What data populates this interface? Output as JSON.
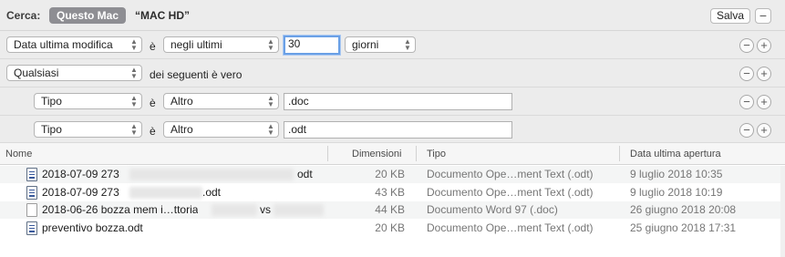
{
  "search": {
    "label": "Cerca:",
    "scope_active": "Questo Mac",
    "scope_other": "“MAC HD”",
    "save_label": "Salva",
    "minus": "−"
  },
  "criteria": [
    {
      "attribute": "Data ultima modifica",
      "op": "è",
      "cond": "negli ultimi",
      "value": "30",
      "unit": "giorni"
    },
    {
      "attribute": "Qualsiasi",
      "text": "dei seguenti è vero"
    },
    {
      "attribute": "Tipo",
      "op": "è",
      "cond": "Altro",
      "value": ".doc"
    },
    {
      "attribute": "Tipo",
      "op": "è",
      "cond": "Altro",
      "value": ".odt"
    }
  ],
  "buttons": {
    "minus": "−",
    "plus": "+"
  },
  "columns": {
    "name": "Nome",
    "size": "Dimensioni",
    "kind": "Tipo",
    "date": "Data ultima apertura"
  },
  "files": [
    {
      "name_start": "2018-07-09 273",
      "name_end": "odt",
      "size": "20 KB",
      "kind": "Documento Ope…ment Text (.odt)",
      "date": "9 luglio 2018 10:35",
      "icon": "odt-document-icon"
    },
    {
      "name_start": "2018-07-09 273",
      "name_end": ".odt",
      "size": "43 KB",
      "kind": "Documento Ope…ment Text (.odt)",
      "date": "9 luglio 2018 10:19",
      "icon": "odt-document-icon"
    },
    {
      "name_start": "2018-06-26 bozza mem i…ttoria",
      "name_end": "vs",
      "size": "44 KB",
      "kind": "Documento Word 97 (.doc)",
      "date": "26 giugno 2018 20:08",
      "icon": "doc-document-icon"
    },
    {
      "name_start": "preventivo bozza.odt",
      "name_end": "",
      "size": "20 KB",
      "kind": "Documento Ope…ment Text (.odt)",
      "date": "25 giugno 2018 17:31",
      "icon": "odt-document-icon"
    }
  ]
}
